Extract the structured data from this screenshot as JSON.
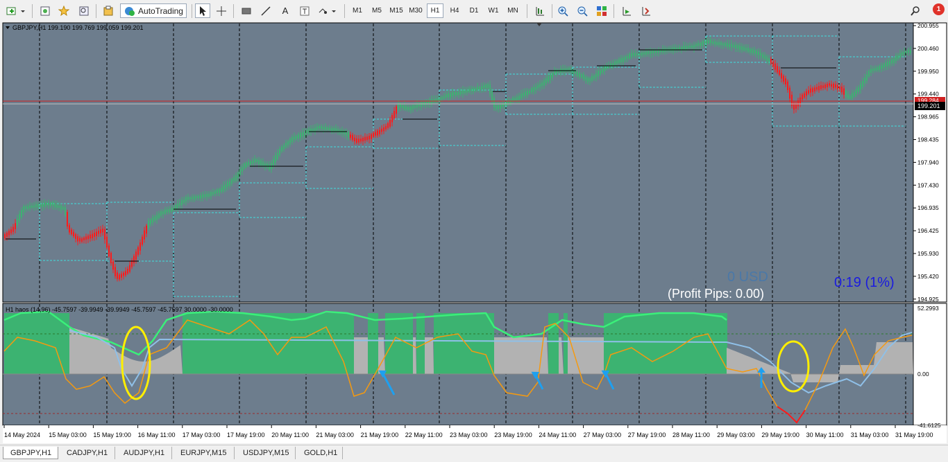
{
  "toolbar": {
    "autotrading_label": "AutoTrading",
    "timeframes": [
      "M1",
      "M5",
      "M15",
      "M30",
      "H1",
      "H4",
      "D1",
      "W1",
      "MN"
    ],
    "active_timeframe": "H1",
    "notification_count": "1"
  },
  "main_chart": {
    "header": "GBPJPY,H1  199.190 199.769 199.059 199.201",
    "price_labels": [
      "200.955",
      "200.460",
      "199.950",
      "199.440",
      "198.965",
      "198.435",
      "197.940",
      "197.430",
      "196.935",
      "196.425",
      "195.930",
      "195.420",
      "194.925"
    ],
    "current_price_label": "199.201",
    "red_line_label": "199.284",
    "profit_usd": "0 USD",
    "profit_pips": "(Profit Pips: 0.00)",
    "timer": "0:19 (1%)"
  },
  "indicator": {
    "header": "H1 haos  (14,96) -45.7597 -39.9949 -39.9949 -45.7597 -45.7597 30.0000 -30.0000",
    "scale_labels": [
      "52.2993",
      "0.00",
      "-41.6125"
    ]
  },
  "time_axis": [
    "14 May 2024",
    "15 May 03:00",
    "15 May 19:00",
    "16 May 11:00",
    "17 May 03:00",
    "17 May 19:00",
    "20 May 11:00",
    "21 May 03:00",
    "21 May 19:00",
    "22 May 11:00",
    "23 May 03:00",
    "23 May 19:00",
    "24 May 11:00",
    "27 May 03:00",
    "27 May 19:00",
    "28 May 11:00",
    "29 May 03:00",
    "29 May 19:00",
    "30 May 11:00",
    "31 May 03:00",
    "31 May 19:00"
  ],
  "colors": {
    "chart_bg": "#6d7d8d",
    "bull": "#3cb371",
    "bear": "#ff1a1a",
    "grid": "#000000",
    "band": "#40e0e0"
  },
  "symbol_tabs": [
    "GBPJPY,H1",
    "CADJPY,H1",
    "AUDJPY,H1",
    "EURJPY,M15",
    "USDJPY,M15",
    "GOLD,H1"
  ]
}
